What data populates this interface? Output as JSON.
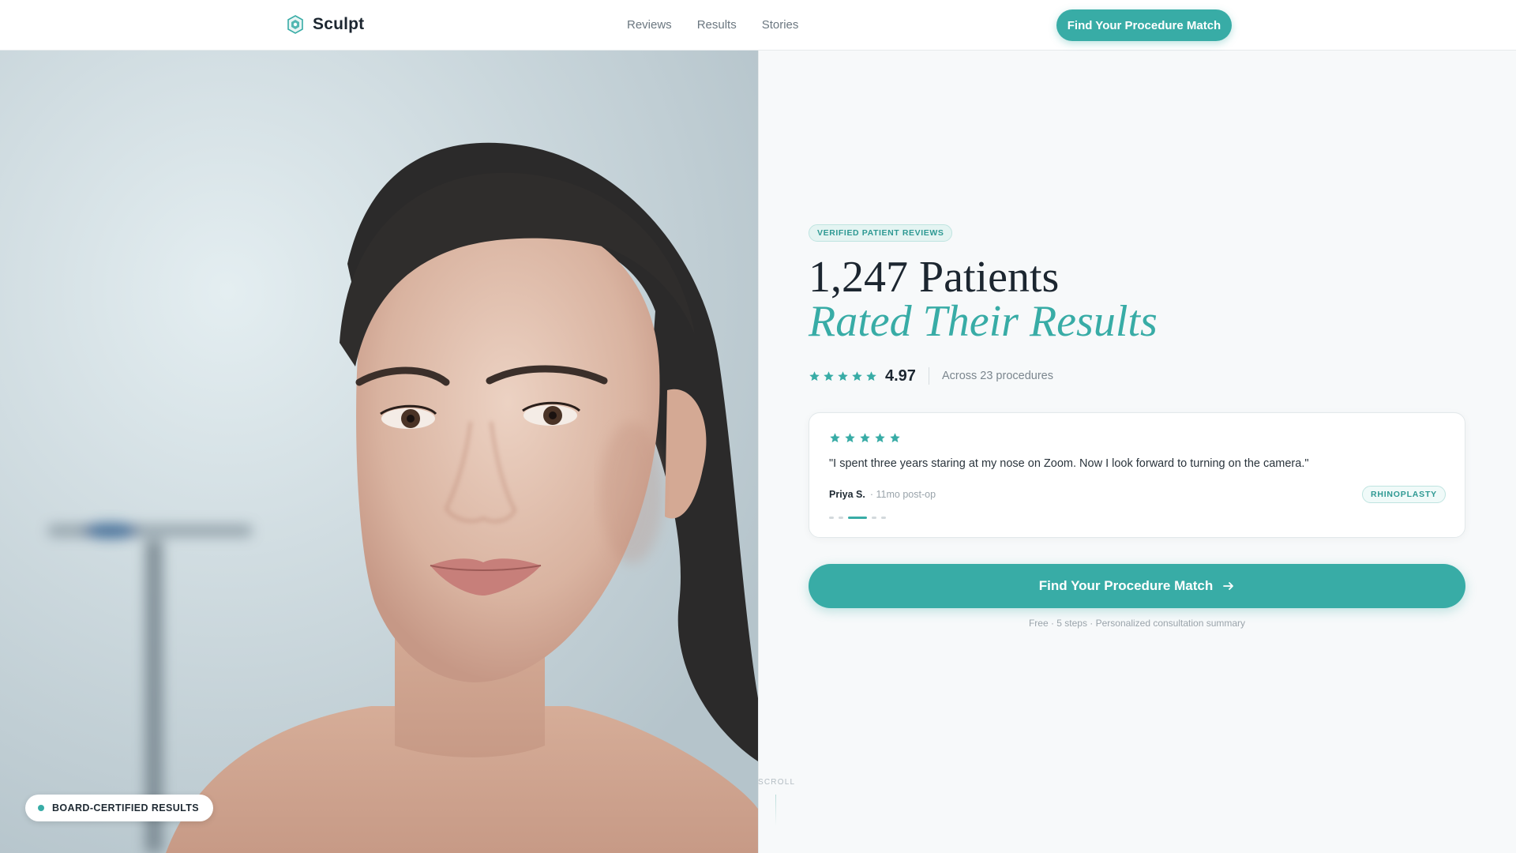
{
  "header": {
    "brand": "Sculpt",
    "nav": [
      "Reviews",
      "Results",
      "Stories"
    ],
    "cta": "Find Your Procedure Match"
  },
  "hero": {
    "photo_badge": "BOARD-CERTIFIED RESULTS",
    "pill": "VERIFIED PATIENT REVIEWS",
    "title_line1": "1,247 Patients",
    "title_line2": "Rated Their Results",
    "rating_stars": 5,
    "rating_score": "4.97",
    "rating_sub": "Across 23 procedures"
  },
  "review": {
    "stars": 5,
    "quote": "\"I spent three years staring at my nose on Zoom. Now I look forward to turning on the camera.\"",
    "name": "Priya S.",
    "meta": "· 11mo post-op",
    "tag": "RHINOPLASTY",
    "carousel_total": 5,
    "carousel_active": 3
  },
  "cta": {
    "label": "Find Your Procedure Match",
    "sub": "Free · 5 steps · Personalized consultation summary"
  },
  "scroll_label": "SCROLL",
  "colors": {
    "accent": "#38aca6",
    "text": "#1c2630",
    "muted": "#7b868e"
  }
}
